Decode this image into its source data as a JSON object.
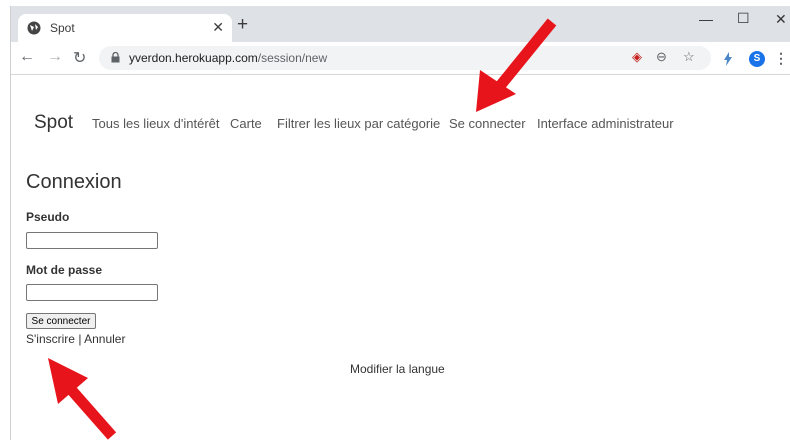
{
  "browser": {
    "tab_title": "Spot",
    "url_host": "yverdon.herokuapp.com",
    "url_path": "/session/new",
    "profile_initial": "S",
    "accent_color": "#1a73e8",
    "annotation_color": "#e8141b"
  },
  "nav": {
    "brand": "Spot",
    "links": [
      "Tous les lieux d'intérêt",
      "Carte",
      "Filtrer les lieux par catégorie",
      "Se connecter",
      "Interface administrateur"
    ]
  },
  "form": {
    "heading": "Connexion",
    "username_label": "Pseudo",
    "username_value": "",
    "password_label": "Mot de passe",
    "password_value": "",
    "submit_label": "Se connecter",
    "signup_link": "S'inscrire",
    "separator": "|",
    "cancel_link": "Annuler"
  },
  "footer": {
    "language_link": "Modifier la langue"
  }
}
